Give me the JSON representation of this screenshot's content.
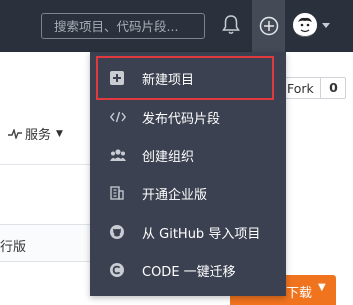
{
  "header": {
    "search_placeholder": "搜索项目、代码片段...",
    "bell_icon": "bell-icon",
    "plus_icon": "plus-circle-icon",
    "avatar_icon": "user-avatar"
  },
  "page": {
    "fork_label": "Fork",
    "fork_count": "0",
    "service_label": "服务",
    "edition_fragment": "行版",
    "download_fragment": "下载"
  },
  "menu": {
    "items": [
      {
        "label": "新建项目",
        "icon": "new-project-icon"
      },
      {
        "label": "发布代码片段",
        "icon": "code-icon"
      },
      {
        "label": "创建组织",
        "icon": "group-icon"
      },
      {
        "label": "开通企业版",
        "icon": "enterprise-icon"
      },
      {
        "label": "从 GitHub 导入项目",
        "icon": "github-icon"
      },
      {
        "label": "CODE 一键迁移",
        "icon": "code-migrate-icon"
      }
    ]
  },
  "colors": {
    "topbar": "#2b313c",
    "menu_bg": "#3b4150",
    "highlight_border": "#e0393e",
    "download_button": "#f0731e"
  }
}
